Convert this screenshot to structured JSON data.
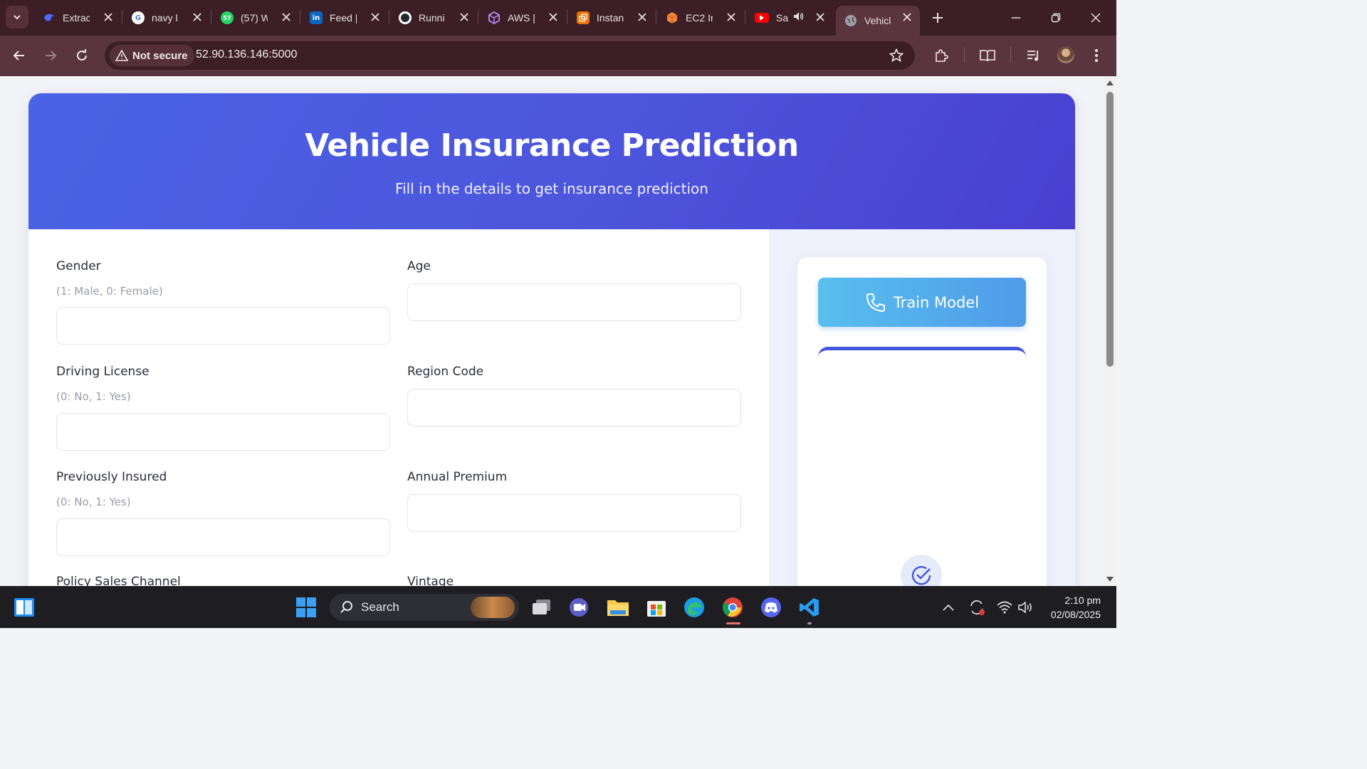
{
  "browser": {
    "tabs": [
      {
        "title": "Extrac",
        "icon": "deepseek-icon",
        "color": "#4d6bfe"
      },
      {
        "title": "navy l",
        "icon": "google-icon",
        "color": "#ffffff"
      },
      {
        "title": "(57) W",
        "icon": "whatsapp-icon",
        "color": "#25d366"
      },
      {
        "title": "Feed |",
        "icon": "linkedin-icon",
        "color": "#0a66c2"
      },
      {
        "title": "Runni",
        "icon": "github-icon",
        "color": "#ffffff"
      },
      {
        "title": "AWS |",
        "icon": "aws-cube-icon",
        "color": "#9b6cf2"
      },
      {
        "title": "Instan",
        "icon": "ec2-icon",
        "color": "#ed7100"
      },
      {
        "title": "EC2 Ir",
        "icon": "ec2-box-icon",
        "color": "#f58536"
      },
      {
        "title": "Sa",
        "icon": "youtube-icon",
        "color": "#ff0000"
      },
      {
        "title": "Vehicl",
        "icon": "globe-icon",
        "color": "#9aa0a6"
      }
    ],
    "not_secure_label": "Not secure",
    "url": "52.90.136.146:5000"
  },
  "page": {
    "title": "Vehicle Insurance Prediction",
    "subtitle": "Fill in the details to get insurance prediction",
    "fields": {
      "gender": {
        "label": "Gender",
        "hint": "(1: Male, 0: Female)",
        "value": ""
      },
      "age": {
        "label": "Age",
        "value": ""
      },
      "driving_license": {
        "label": "Driving License",
        "hint": "(0: No, 1: Yes)",
        "value": ""
      },
      "region_code": {
        "label": "Region Code",
        "value": ""
      },
      "previously_insured": {
        "label": "Previously Insured",
        "hint": "(0: No, 1: Yes)",
        "value": ""
      },
      "annual_premium": {
        "label": "Annual Premium",
        "value": ""
      },
      "policy_sales_channel": {
        "label": "Policy Sales Channel"
      },
      "vintage": {
        "label": "Vintage"
      }
    },
    "train_button": "Train Model"
  },
  "taskbar": {
    "search_label": "Search",
    "time": "2:10 pm",
    "date": "02/08/2025"
  },
  "colors": {
    "hero_start": "#4a63e6",
    "hero_end": "#4a3fd0",
    "train_button": "#58bfee",
    "accent": "#4257de"
  }
}
